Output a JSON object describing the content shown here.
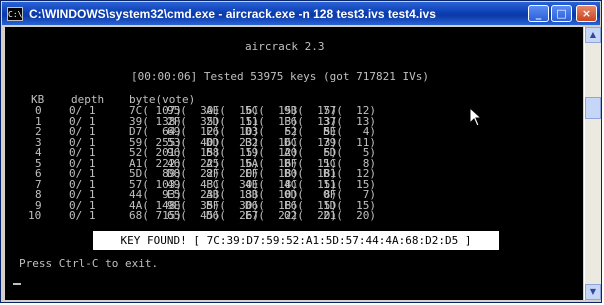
{
  "window": {
    "title": "C:\\WINDOWS\\system32\\cmd.exe - aircrack.exe -n 128 test3.ivs test4.ivs",
    "icon_text": "C:\\",
    "buttons": {
      "minimize": "_",
      "maximize": "□",
      "close": "×"
    }
  },
  "console": {
    "heading": "aircrack 2.3",
    "status": "[00:00:06] Tested 53975 keys (got 717821 IVs)",
    "columns": [
      "KB",
      "depth",
      "byte(vote)"
    ],
    "rows": [
      {
        "kb": "0",
        "depth": "0/ 1",
        "votes": [
          "7C( 107)",
          "95(  30)",
          "AE(  16)",
          "5C(  15)",
          "9B(  15)",
          "77(  12)"
        ]
      },
      {
        "kb": "1",
        "depth": "0/ 1",
        "votes": [
          "39( 138)",
          "2F(  35)",
          "2D(  15)",
          "11(  13)",
          "F6(  13)",
          "37(  13)"
        ]
      },
      {
        "kb": "2",
        "depth": "0/ 1",
        "votes": [
          "D7(  64)",
          "69(  12)",
          "F6(  10)",
          "D3(   5)",
          "F2(   5)",
          "BE(   4)"
        ]
      },
      {
        "kb": "3",
        "depth": "0/ 1",
        "votes": [
          "59( 255)",
          "53(  40)",
          "DD(  23)",
          "B2(  16)",
          "DC(  13)",
          "79(  11)"
        ]
      },
      {
        "kb": "4",
        "depth": "0/ 1",
        "votes": [
          "52( 201)",
          "96(  15)",
          "B8(  15)",
          "19(  12)",
          "A0(   5)",
          "FD(   5)"
        ]
      },
      {
        "kb": "5",
        "depth": "0/ 1",
        "votes": [
          "A1( 222)",
          "46(  22)",
          "A5(  16)",
          "5A(  16)",
          "BF(  11)",
          "5C(   8)"
        ]
      },
      {
        "kb": "6",
        "depth": "0/ 1",
        "votes": [
          "5D(  89)",
          "D8(  22)",
          "8F(  20)",
          "EF(  18)",
          "B0(  18)",
          "B1(  12)"
        ]
      },
      {
        "kb": "7",
        "depth": "0/ 1",
        "votes": [
          "57( 103)",
          "49(  43)",
          "FC(  30)",
          "4E(  18)",
          "4C(  15)",
          "11(  15)"
        ]
      },
      {
        "kb": "8",
        "depth": "0/ 1",
        "votes": [
          "44(  93)",
          "E5(  23)",
          "AB(  13)",
          "8B(  10)",
          "0D(   8)",
          "0F(   7)"
        ]
      },
      {
        "kb": "9",
        "depth": "0/ 1",
        "votes": [
          "4A( 148)",
          "9E(  35)",
          "BF(  30)",
          "D6(  18)",
          "E6(  15)",
          "1D(  15)"
        ]
      },
      {
        "kb": "10",
        "depth": "0/ 1",
        "votes": [
          "68( 715)",
          "65(  45)",
          "D6(  26)",
          "E7(  22)",
          "02(  20)",
          "21(  20)"
        ]
      }
    ],
    "key_found": "KEY FOUND! [ 7C:39:D7:59:52:A1:5D:57:44:4A:68:D2:D5 ]",
    "prompt": "Press Ctrl-C to exit."
  },
  "colors": {
    "console_bg": "#000000",
    "console_text": "#c0c0c0",
    "title_bar": "#0d3fb4"
  },
  "scrollbar": {
    "up_icon": "▲",
    "down_icon": "▼"
  }
}
